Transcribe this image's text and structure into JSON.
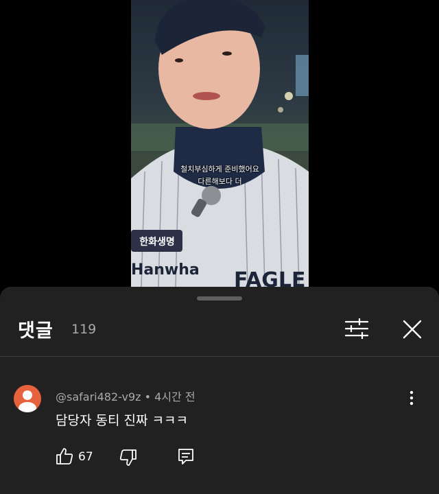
{
  "video": {
    "subtitle_line1": "철치부심하게 준비했어요",
    "subtitle_line2": "다른해보다 더"
  },
  "comments_panel": {
    "title": "댓글",
    "count": "119",
    "filter_icon": "sort-filter-icon",
    "close_icon": "close-icon"
  },
  "comment": {
    "author_meta": "@safari482-v9z • 4시간 전",
    "text": "담당자 동티 진짜 ㅋㅋㅋ",
    "like_count": "67",
    "avatar_color": "#e8613d"
  },
  "colors": {
    "sheet_background": "#212121",
    "secondary_text": "#aaaaaa"
  }
}
